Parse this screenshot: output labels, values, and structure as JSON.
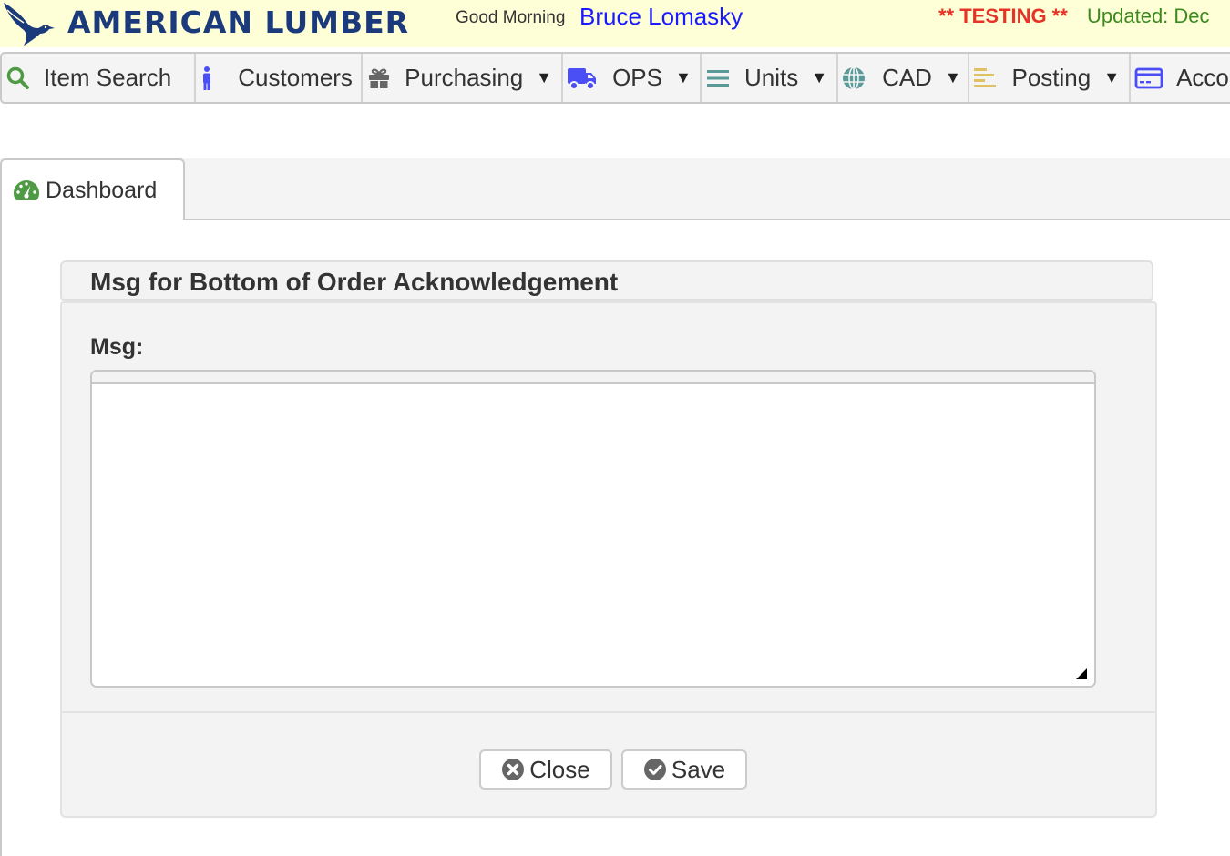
{
  "header": {
    "brand": "AMERICAN LUMBER",
    "greeting": "Good Morning",
    "user_name": "Bruce Lomasky",
    "testing_banner": "** TESTING **",
    "updated_text": "Updated: Dec",
    "colors": {
      "banner_bg": "#ffffd7",
      "brand": "#1b3a7c",
      "user_name": "#1a1aff",
      "testing": "#e53427",
      "updated": "#3c8a1e"
    }
  },
  "navbar": {
    "items": [
      {
        "label": "Item Search",
        "icon": "search-icon",
        "has_dropdown": false,
        "icon_color": "#4f9a45"
      },
      {
        "label": "Customers",
        "icon": "person-icon",
        "has_dropdown": false,
        "icon_color": "#4a4ef5"
      },
      {
        "label": "Purchasing",
        "icon": "gift-icon",
        "has_dropdown": true,
        "icon_color": "#666666"
      },
      {
        "label": "OPS",
        "icon": "truck-icon",
        "has_dropdown": true,
        "icon_color": "#4a4ef5"
      },
      {
        "label": "Units",
        "icon": "bars-icon",
        "has_dropdown": true,
        "icon_color": "#5a9a98"
      },
      {
        "label": "CAD",
        "icon": "globe-icon",
        "has_dropdown": true,
        "icon_color": "#5a9a98"
      },
      {
        "label": "Posting",
        "icon": "align-left-icon",
        "has_dropdown": true,
        "icon_color": "#e0c060"
      },
      {
        "label": "Acco",
        "icon": "credit-card-icon",
        "has_dropdown": false,
        "icon_color": "#4a4ef5"
      }
    ],
    "caret": "▼"
  },
  "tabs": [
    {
      "label": "Dashboard",
      "icon": "dashboard-gauge-icon",
      "active": true,
      "icon_color": "#4f9a45"
    }
  ],
  "dialog": {
    "title": "Msg for Bottom of Order Acknowledgement",
    "field_label": "Msg:",
    "field_value": "",
    "buttons": {
      "close": "Close",
      "save": "Save"
    }
  }
}
